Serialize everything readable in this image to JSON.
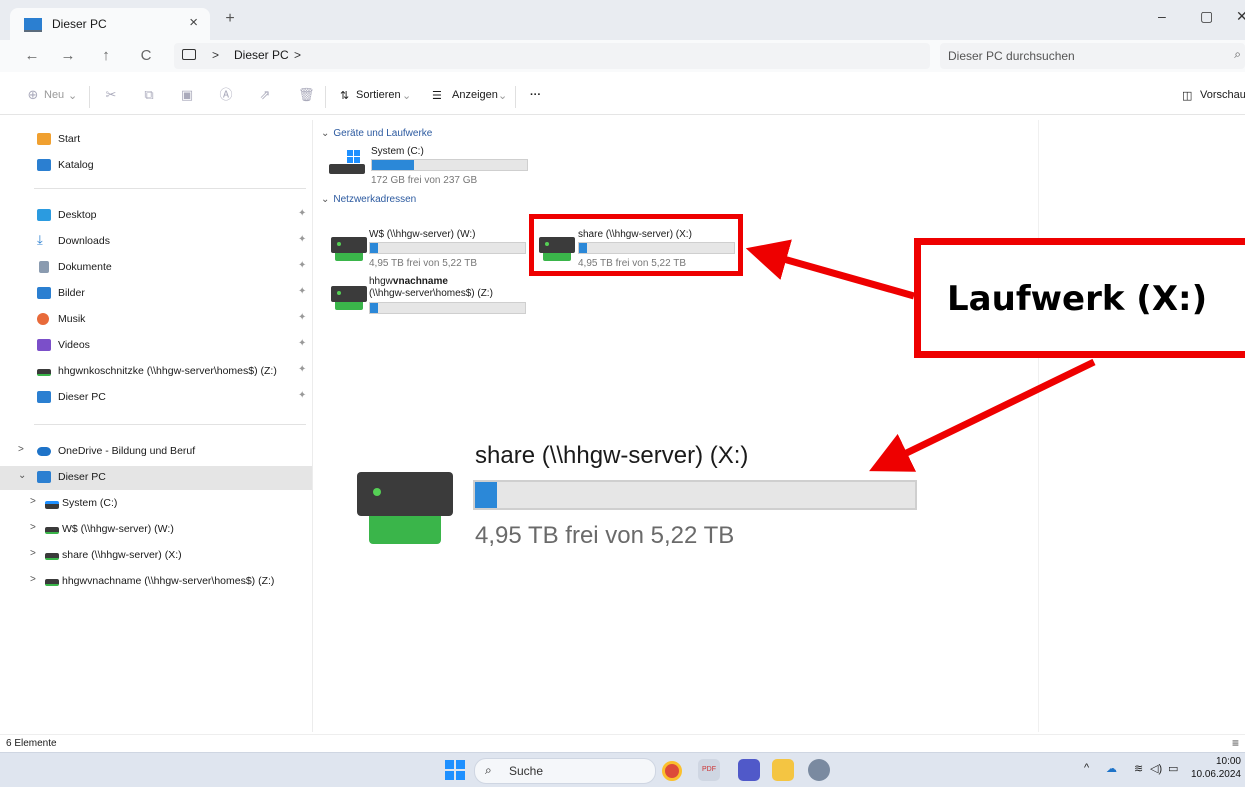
{
  "window": {
    "tab_title": "Dieser PC",
    "tab_close": "×",
    "new_tab": "+",
    "minimize": "–",
    "restore": "▢",
    "close": "✕"
  },
  "address": {
    "back": "←",
    "forward": "→",
    "up": "↑",
    "refresh": "C",
    "separator": ">",
    "breadcrumb": "Dieser PC",
    "search_placeholder": "Dieser PC durchsuchen"
  },
  "toolbar": {
    "new_label": "Neu",
    "sort_label": "Sortieren",
    "view_label": "Anzeigen",
    "more_label": "···",
    "preview_label": "Vorschau"
  },
  "sidebar": {
    "quick": [
      {
        "label": "Start",
        "icon": "home-icon",
        "color": "#f0a030"
      },
      {
        "label": "Katalog",
        "icon": "gallery-icon",
        "color": "#2b7fd1"
      }
    ],
    "pinned": [
      {
        "label": "Desktop",
        "icon": "desktop-folder-icon",
        "color": "#2b9be0"
      },
      {
        "label": "Downloads",
        "icon": "download-icon",
        "color": "#2b7fd1"
      },
      {
        "label": "Dokumente",
        "icon": "documents-icon",
        "color": "#8a9bb0"
      },
      {
        "label": "Bilder",
        "icon": "pictures-icon",
        "color": "#2b7fd1"
      },
      {
        "label": "Musik",
        "icon": "music-icon",
        "color": "#e86a3a"
      },
      {
        "label": "Videos",
        "icon": "videos-icon",
        "color": "#7b4fc9"
      },
      {
        "label": "hhgwnkoschnitzke (\\\\hhgw-server\\homes$) (Z:)",
        "icon": "network-drive-icon",
        "color": "#3a3a3a"
      },
      {
        "label": "Dieser PC",
        "icon": "this-pc-icon",
        "color": "#2b7fd1"
      }
    ],
    "tree": [
      {
        "label": "OneDrive - Bildung und Beruf",
        "icon": "onedrive-icon",
        "color": "#1e73c8",
        "level": 0
      },
      {
        "label": "Dieser PC",
        "icon": "this-pc-icon",
        "color": "#2b7fd1",
        "level": 0
      },
      {
        "label": "System (C:)",
        "icon": "system-drive-icon",
        "color": "#3a3a3a",
        "level": 1
      },
      {
        "label": "W$ (\\\\hhgw-server) (W:)",
        "icon": "network-drive-icon",
        "color": "#3a3a3a",
        "level": 1
      },
      {
        "label": "share (\\\\hhgw-server) (X:)",
        "icon": "network-drive-icon",
        "color": "#3a3a3a",
        "level": 1
      },
      {
        "label": "hhgwvnachname (\\\\hhgw-server\\homes$) (Z:)",
        "icon": "network-drive-icon",
        "color": "#3a3a3a",
        "level": 1
      }
    ]
  },
  "main": {
    "group_devices": "Geräte und Laufwerke",
    "group_network": "Netzwerkadressen",
    "drives": [
      {
        "label": "System (C:)",
        "free_text": "172 GB frei von 237 GB",
        "used_fraction": 0.27
      },
      {
        "label": "W$ (\\\\hhgw-server) (W:)",
        "free_text": "4,95 TB frei von 5,22 TB",
        "used_fraction": 0.05
      },
      {
        "label": "share (\\\\hhgw-server) (X:)",
        "free_text": "4,95 TB frei von 5,22 TB",
        "used_fraction": 0.05
      },
      {
        "label_prefix": "hhgw",
        "label_bold": "vnachname",
        "label_line2": "(\\\\hhgw-server\\homes$) (Z:)",
        "used_fraction": 0.05
      }
    ]
  },
  "annotation": {
    "callout_text": "Laufwerk (X:)",
    "accent_color": "#ee0000"
  },
  "zoom": {
    "label": "share (\\\\hhgw-server) (X:)",
    "free_text": "4,95 TB frei von 5,22 TB",
    "used_fraction": 0.05
  },
  "status": {
    "count": "6 Elemente"
  },
  "taskbar": {
    "search_placeholder": "Suche",
    "time": "10:00",
    "date": "10.06.2024"
  }
}
